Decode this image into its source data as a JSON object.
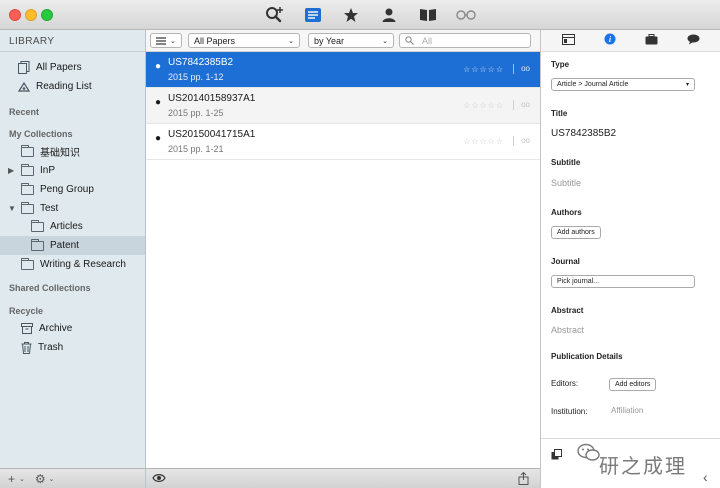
{
  "toolbar": {
    "icons": [
      "search-add-icon",
      "papers-list-icon",
      "star-icon",
      "person-icon",
      "book-icon",
      "glasses-icon"
    ]
  },
  "sidebar": {
    "header": "LIBRARY",
    "top_items": [
      {
        "label": "All Papers",
        "icon": "papers-icon"
      },
      {
        "label": "Reading List",
        "icon": "reading-list-icon"
      }
    ],
    "sections": {
      "recent": "Recent",
      "collections": "My Collections",
      "shared": "Shared Collections",
      "recycle": "Recycle"
    },
    "collections": [
      {
        "label": "基础知识",
        "level": 0
      },
      {
        "label": "InP",
        "level": 0,
        "disclosure": "▶"
      },
      {
        "label": "Peng Group",
        "level": 0
      },
      {
        "label": "Test",
        "level": 0,
        "disclosure": "▼"
      },
      {
        "label": "Articles",
        "level": 1
      },
      {
        "label": "Patent",
        "level": 1,
        "selected": true
      },
      {
        "label": "Writing & Research",
        "level": 0
      }
    ],
    "recycle_items": [
      {
        "label": "Archive",
        "icon": "archive-icon"
      },
      {
        "label": "Trash",
        "icon": "trash-icon"
      }
    ],
    "footer": {
      "add": "+",
      "gear": "⚙"
    }
  },
  "filterbar": {
    "scope_value": "All Papers",
    "sort_value": "by Year",
    "search_placeholder": "All"
  },
  "papers": [
    {
      "title": "US7842385B2",
      "meta": "2015 pp. 1-12",
      "selected": true
    },
    {
      "title": "US20140158937A1",
      "meta": "2015 pp. 1-25"
    },
    {
      "title": "US20150041715A1",
      "meta": "2015 pp. 1-21"
    }
  ],
  "paper_stars": "☆☆☆☆☆",
  "inspector": {
    "type_label": "Type",
    "type_value": "Article > Journal Article",
    "title_label": "Title",
    "title_value": "US7842385B2",
    "subtitle_label": "Subtitle",
    "subtitle_placeholder": "Subtitle",
    "authors_label": "Authors",
    "add_authors": "Add authors",
    "journal_label": "Journal",
    "pick_journal": "Pick journal...",
    "abstract_label": "Abstract",
    "abstract_placeholder": "Abstract",
    "pub_details_label": "Publication Details",
    "editors_label": "Editors:",
    "add_editors": "Add editors",
    "institution_label": "Institution:",
    "institution_placeholder": "Affiliation",
    "footer_collapse": "‹"
  },
  "watermark": "研之成理",
  "colors": {
    "selection_blue": "#1d6fd6",
    "sidebar_bg": "#dfe9ee",
    "accent_blue": "#1a73e8"
  }
}
